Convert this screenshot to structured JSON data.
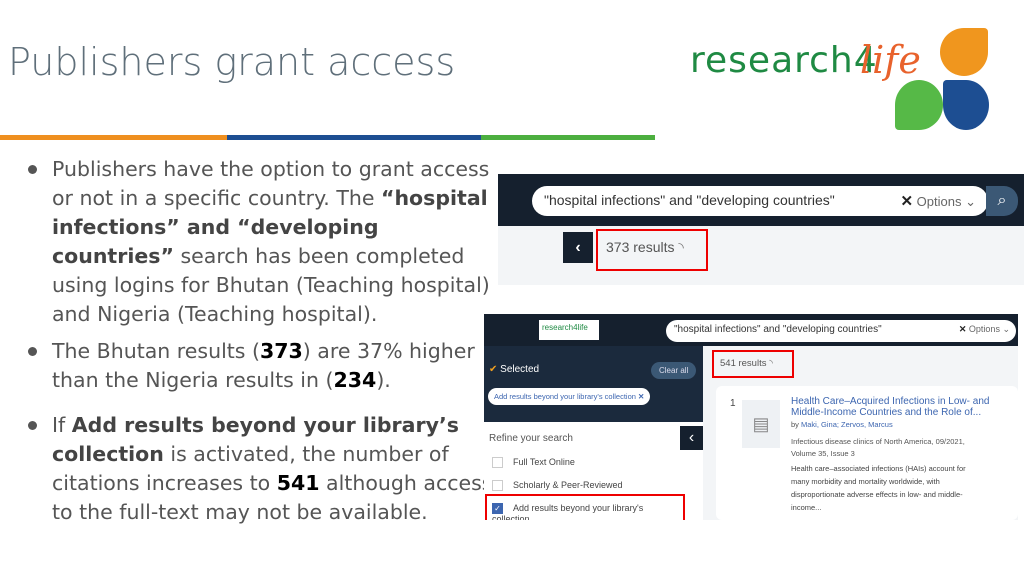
{
  "slide": {
    "title": "Publishers grant access",
    "logo_text": "research4life",
    "colors": {
      "orange": "#ef8f1f",
      "blue": "#1d4e92",
      "green": "#4caf3f",
      "navy": "#15202e"
    }
  },
  "bullets": [
    {
      "pre": "Publishers have the option to grant access or not in a specific country.   The ",
      "b1": "“hospital infections” and “developing countries”",
      "post": " search has been completed using logins for Bhutan (Teaching hospital) and Nigeria (Teaching hospital)."
    },
    {
      "pre": "The Bhutan results  (",
      "n1": "373",
      "mid": ") are 37% higher than the Nigeria results in (",
      "n2": "234",
      "post": ")."
    },
    {
      "pre": "If ",
      "b1": "Add results beyond your library’s collection",
      "mid": " is activated, the number of citations increases to ",
      "n1": "541",
      "post": " although access to the full-text may not be available."
    }
  ],
  "shot1": {
    "query": "\"hospital infections\" and \"developing countries\"",
    "options": "Options",
    "results": "373 results"
  },
  "shot2": {
    "logo": "research4life",
    "query": "\"hospital infections\" and \"developing countries\"",
    "options": "Options",
    "selected": "Selected",
    "clear_all": "Clear all",
    "chip": "Add results beyond your library's collection",
    "refine": "Refine your search",
    "filters": [
      {
        "label": "Full Text Online",
        "checked": false
      },
      {
        "label": "Scholarly & Peer-Reviewed",
        "checked": false
      },
      {
        "label": "Add results beyond your library's collection",
        "checked": true
      }
    ],
    "results": "541 results",
    "item": {
      "num": "1",
      "title": "Health Care–Acquired Infections in Low- and Middle-Income Countries and the Role of...",
      "authors_prefix": "by",
      "authors": "Maki, Gina; Zervos, Marcus",
      "source": "Infectious disease clinics of North America, 09/2021, Volume 35, Issue 3",
      "snippet": "Health care–associated infections (HAIs) account for many morbidity and mortality worldwide, with disproportionate adverse effects in low- and middle-income..."
    }
  }
}
